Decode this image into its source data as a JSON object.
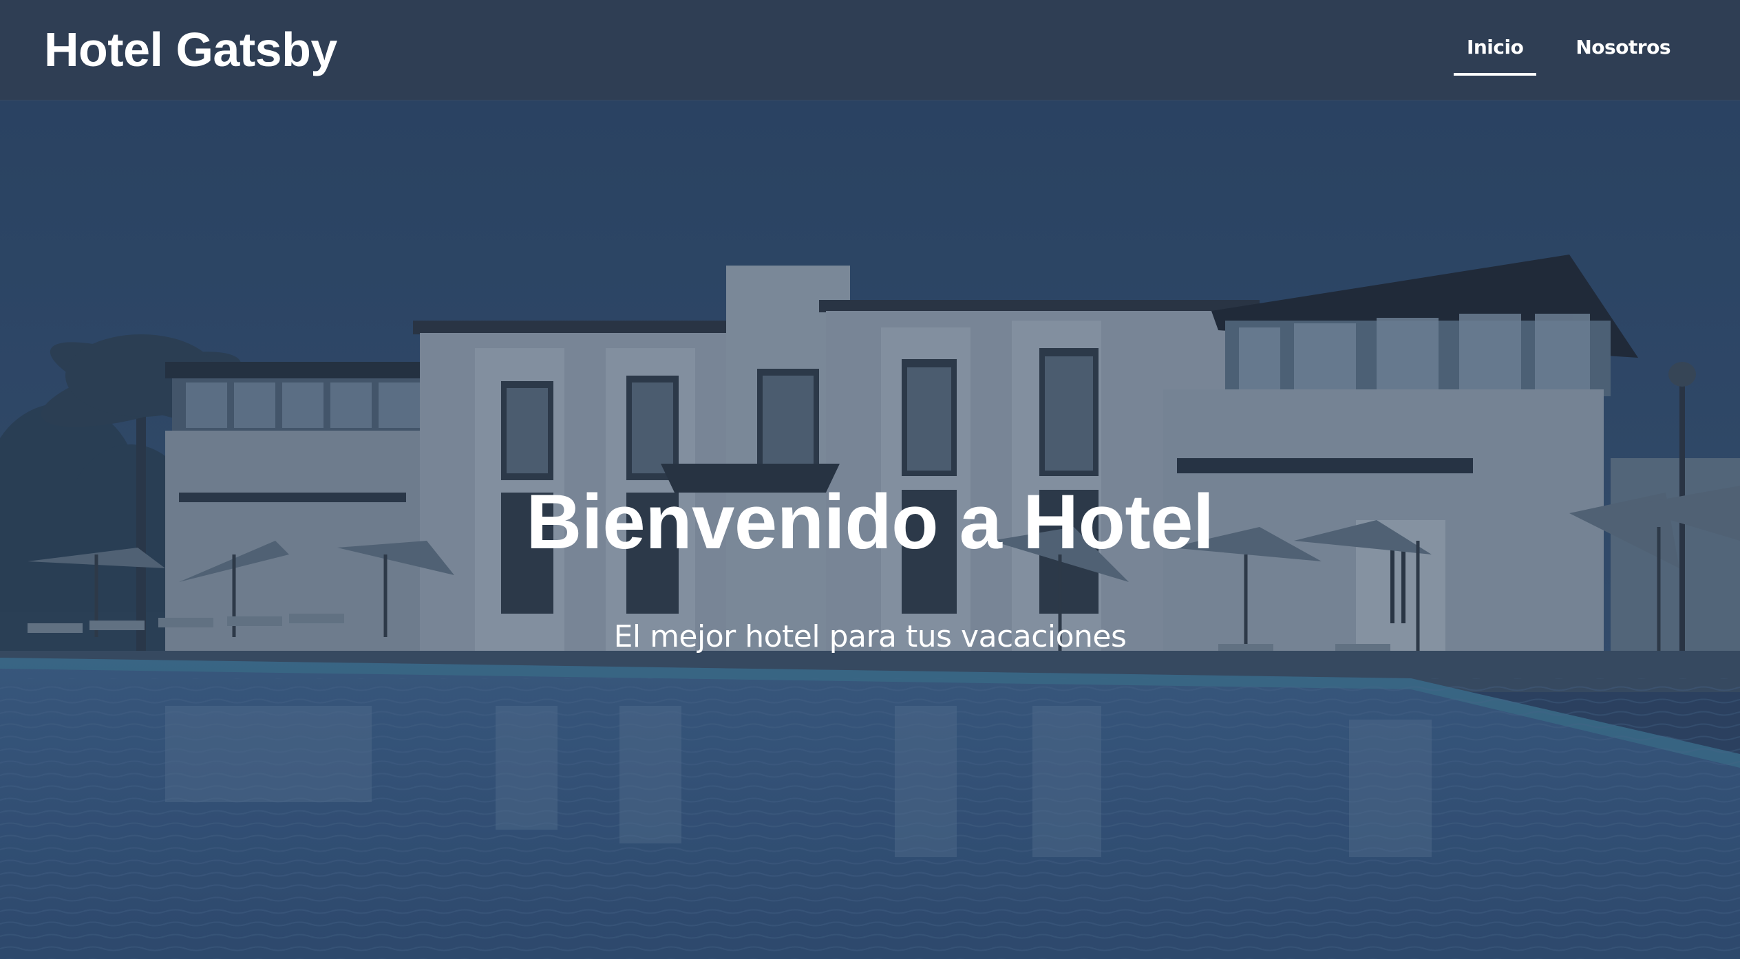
{
  "header": {
    "brand": "Hotel Gatsby",
    "nav": [
      {
        "label": "Inicio",
        "active": true
      },
      {
        "label": "Nosotros",
        "active": false
      }
    ]
  },
  "hero": {
    "title": "Bienvenido a Hotel",
    "subtitle": "El mejor hotel para tus vacaciones",
    "background_image": "hotel-pool-night-image"
  },
  "colors": {
    "header_bg": "#2f3e54",
    "overlay": "#2d4566",
    "text": "#ffffff"
  }
}
